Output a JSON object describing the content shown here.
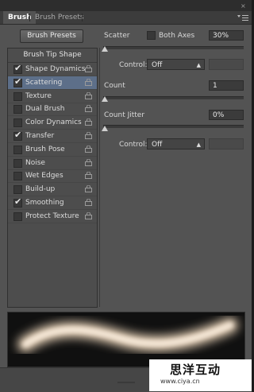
{
  "tabs": [
    {
      "label": "Brush",
      "active": true
    },
    {
      "label": "Brush Presets",
      "active": false
    }
  ],
  "close_label": "× ×",
  "panel_menu_icon": "panel-menu-icon",
  "brush_presets_button": "Brush Presets",
  "list_header": "Brush Tip Shape",
  "options": [
    {
      "label": "Shape Dynamics",
      "checked": true,
      "selected": false
    },
    {
      "label": "Scattering",
      "checked": true,
      "selected": true
    },
    {
      "label": "Texture",
      "checked": false,
      "selected": false
    },
    {
      "label": "Dual Brush",
      "checked": false,
      "selected": false
    },
    {
      "label": "Color Dynamics",
      "checked": false,
      "selected": false
    },
    {
      "label": "Transfer",
      "checked": true,
      "selected": false
    },
    {
      "label": "Brush Pose",
      "checked": false,
      "selected": false
    },
    {
      "label": "Noise",
      "checked": false,
      "selected": false
    },
    {
      "label": "Wet Edges",
      "checked": false,
      "selected": false
    },
    {
      "label": "Build-up",
      "checked": false,
      "selected": false
    },
    {
      "label": "Smoothing",
      "checked": true,
      "selected": false
    },
    {
      "label": "Protect Texture",
      "checked": false,
      "selected": false
    }
  ],
  "scatter": {
    "label": "Scatter",
    "both_axes_label": "Both Axes",
    "both_axes_checked": false,
    "value": "30%",
    "slider_level": 0.0,
    "control_label": "Control:",
    "control_value": "Off"
  },
  "count": {
    "label": "Count",
    "value": "1",
    "slider_level": 0.0
  },
  "count_jitter": {
    "label": "Count Jitter",
    "value": "0%",
    "slider_level": 0.0,
    "control_label": "Control:",
    "control_value": "Off"
  },
  "watermark": {
    "text": "思洋互动",
    "url": "www.ciya.cn"
  },
  "colors": {
    "panel": "#535353",
    "selected_row": "#5d6f89",
    "preview_stroke": "#f3dcc0"
  }
}
